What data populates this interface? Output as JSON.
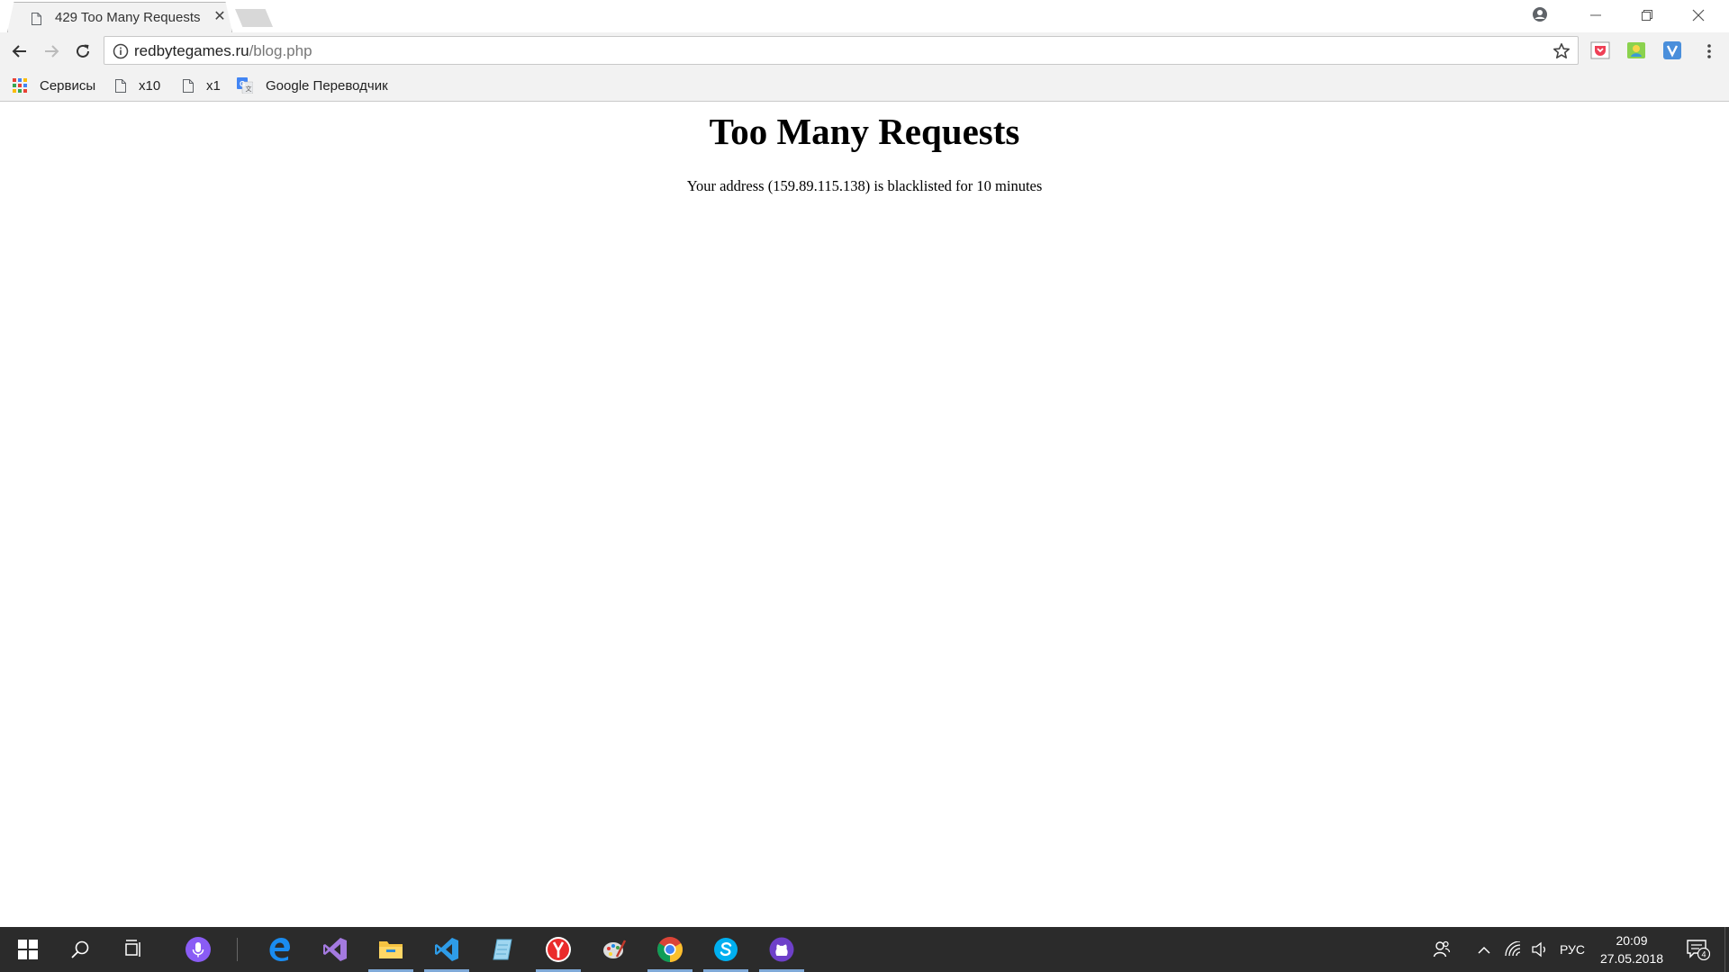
{
  "browser": {
    "tab": {
      "title": "429 Too Many Requests",
      "close_icon": "close-icon"
    },
    "omnibox": {
      "url_host": "redbytegames.ru",
      "url_path": "/blog.php"
    },
    "bookmarks": [
      {
        "label": "Сервисы",
        "icon": "apps-grid-icon"
      },
      {
        "label": "x10",
        "icon": "page-icon"
      },
      {
        "label": "x1",
        "icon": "page-icon"
      },
      {
        "label": "Google Переводчик",
        "icon": "google-translate-icon"
      }
    ],
    "extensions": [
      "pocket-icon",
      "green-extension-icon",
      "v-extension-icon"
    ],
    "accent": "#7fa9d8"
  },
  "page": {
    "heading": "Too Many Requests",
    "message": "Your address (159.89.115.138) is blacklisted for 10 minutes"
  },
  "taskbar": {
    "apps": [
      "windows-start-icon",
      "search-icon",
      "task-view-icon",
      "cortana-icon",
      "edge-icon",
      "visual-studio-icon",
      "file-explorer-icon",
      "vscode-icon",
      "notepad-app-icon",
      "yandex-browser-icon",
      "paint-icon",
      "chrome-icon",
      "skype-icon",
      "github-desktop-icon"
    ],
    "tray": {
      "language": "РУС",
      "time": "20:09",
      "date": "27.05.2018",
      "notification_count": "4"
    }
  }
}
